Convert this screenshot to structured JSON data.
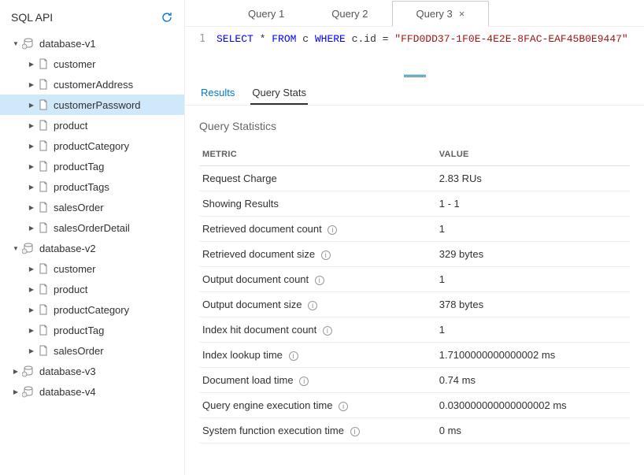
{
  "sidebar": {
    "title": "SQL API",
    "databases": [
      {
        "name": "database-v1",
        "expanded": true,
        "items": [
          {
            "label": "customer",
            "selected": false
          },
          {
            "label": "customerAddress",
            "selected": false
          },
          {
            "label": "customerPassword",
            "selected": true
          },
          {
            "label": "product",
            "selected": false
          },
          {
            "label": "productCategory",
            "selected": false
          },
          {
            "label": "productTag",
            "selected": false
          },
          {
            "label": "productTags",
            "selected": false
          },
          {
            "label": "salesOrder",
            "selected": false
          },
          {
            "label": "salesOrderDetail",
            "selected": false
          }
        ]
      },
      {
        "name": "database-v2",
        "expanded": true,
        "items": [
          {
            "label": "customer",
            "selected": false
          },
          {
            "label": "product",
            "selected": false
          },
          {
            "label": "productCategory",
            "selected": false
          },
          {
            "label": "productTag",
            "selected": false
          },
          {
            "label": "salesOrder",
            "selected": false
          }
        ]
      },
      {
        "name": "database-v3",
        "expanded": false,
        "items": []
      },
      {
        "name": "database-v4",
        "expanded": false,
        "items": []
      }
    ]
  },
  "tabs": [
    {
      "label": "Query 1",
      "active": false
    },
    {
      "label": "Query 2",
      "active": false
    },
    {
      "label": "Query 3",
      "active": true
    }
  ],
  "editor": {
    "line_number": "1",
    "tokens": {
      "select": "SELECT",
      "star": " * ",
      "from": "FROM",
      "c": " c ",
      "where": "WHERE",
      "rest": " c.id = ",
      "string": "\"FFD0DD37-1F0E-4E2E-8FAC-EAF45B0E9447\""
    }
  },
  "result_tabs": {
    "results": "Results",
    "stats": "Query Stats"
  },
  "stats": {
    "title": "Query Statistics",
    "headers": {
      "metric": "METRIC",
      "value": "VALUE"
    },
    "rows": [
      {
        "metric": "Request Charge",
        "value": "2.83 RUs",
        "info": false
      },
      {
        "metric": "Showing Results",
        "value": "1 - 1",
        "info": false
      },
      {
        "metric": "Retrieved document count",
        "value": "1",
        "info": true
      },
      {
        "metric": "Retrieved document size",
        "value": "329 bytes",
        "info": true
      },
      {
        "metric": "Output document count",
        "value": "1",
        "info": true
      },
      {
        "metric": "Output document size",
        "value": "378 bytes",
        "info": true
      },
      {
        "metric": "Index hit document count",
        "value": "1",
        "info": true
      },
      {
        "metric": "Index lookup time",
        "value": "1.7100000000000002 ms",
        "info": true
      },
      {
        "metric": "Document load time",
        "value": "0.74 ms",
        "info": true
      },
      {
        "metric": "Query engine execution time",
        "value": "0.030000000000000002 ms",
        "info": true
      },
      {
        "metric": "System function execution time",
        "value": "0 ms",
        "info": true
      }
    ]
  }
}
